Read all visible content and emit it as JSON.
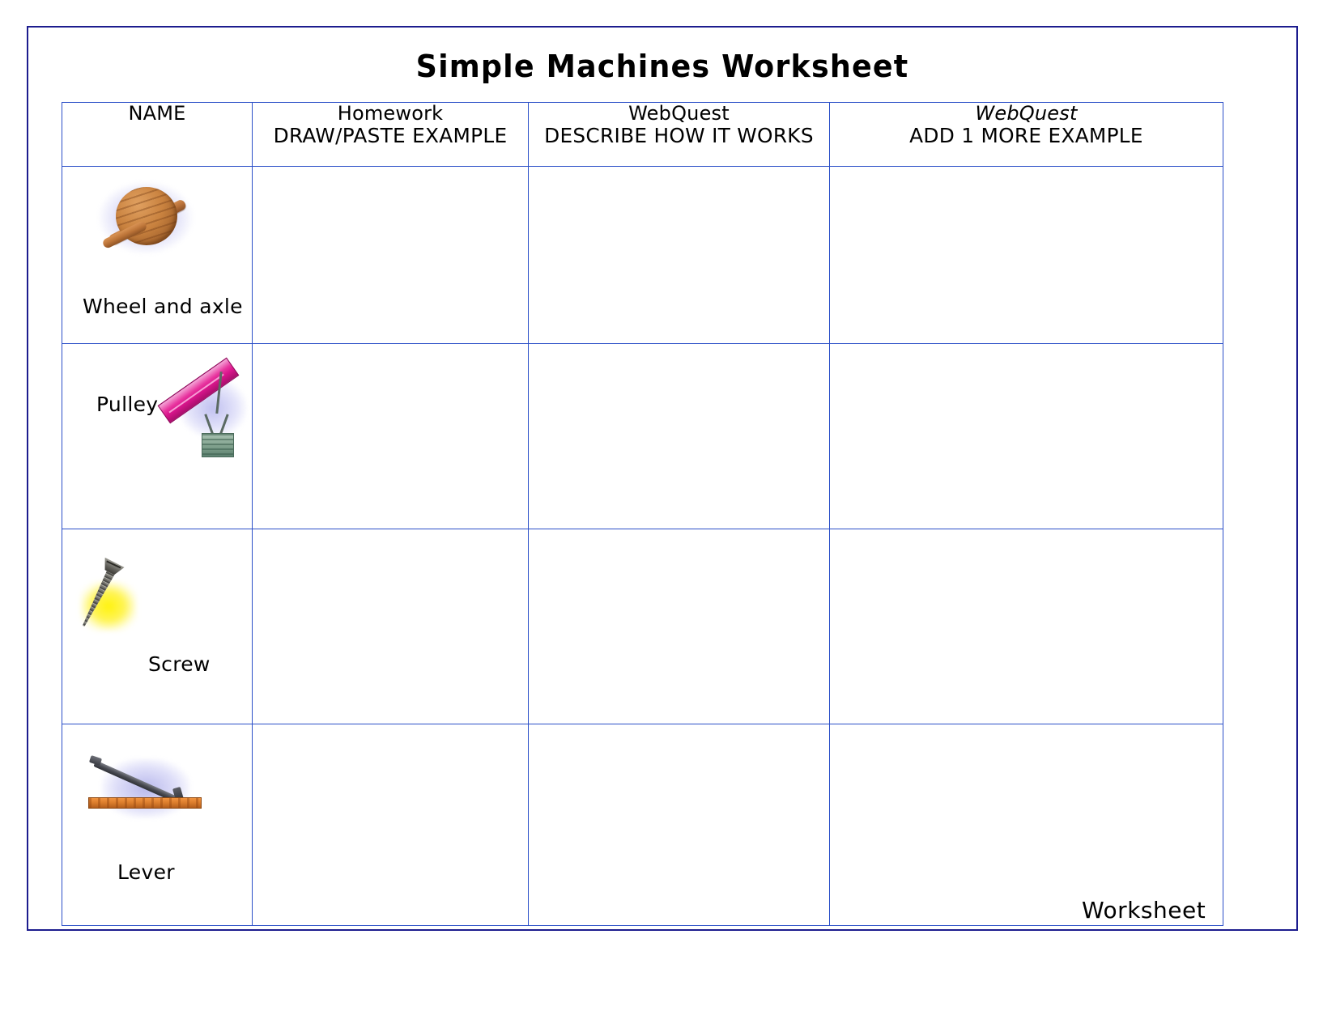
{
  "document": {
    "title": "Simple Machines Worksheet",
    "footer_note": "Worksheet"
  },
  "table": {
    "headers": [
      {
        "id": "name",
        "line1": "NAME",
        "line2": "",
        "line1_italic": false
      },
      {
        "id": "hw",
        "line1": "Homework",
        "line2": "DRAW/PASTE EXAMPLE",
        "line1_italic": false
      },
      {
        "id": "wq1",
        "line1": "WebQuest",
        "line2": "DESCRIBE HOW IT  WORKS",
        "line1_italic": false
      },
      {
        "id": "wq2",
        "line1": "WebQuest",
        "line2": "ADD 1 MORE EXAMPLE",
        "line1_italic": true
      }
    ],
    "rows": [
      {
        "id": "wheel-and-axle",
        "label": "Wheel and axle",
        "icon": "wheel-and-axle-clipart",
        "homework_example": "",
        "webquest_describe": "",
        "webquest_extra_example": ""
      },
      {
        "id": "pulley",
        "label": "Pulley",
        "icon": "pulley-clipart",
        "homework_example": "",
        "webquest_describe": "",
        "webquest_extra_example": ""
      },
      {
        "id": "screw",
        "label": "Screw",
        "icon": "screw-clipart",
        "homework_example": "",
        "webquest_describe": "",
        "webquest_extra_example": ""
      },
      {
        "id": "lever",
        "label": "Lever",
        "icon": "lever-clipart",
        "homework_example": "",
        "webquest_describe": "",
        "webquest_extra_example": ""
      }
    ]
  },
  "colors": {
    "page_border": "#1c1c8e",
    "table_border": "#2b4fc8",
    "text": "#000000",
    "background": "#ffffff",
    "wheel_wood": "#c9823f",
    "pulley_beam": "#e8359f",
    "pulley_bucket": "#7fa08c",
    "screw_metal": "#76756e",
    "screw_glow": "#fff200",
    "lever_plank": "#dd7f2d",
    "lever_bar": "#4a4c54",
    "clipart_glow": "#9696e2"
  }
}
